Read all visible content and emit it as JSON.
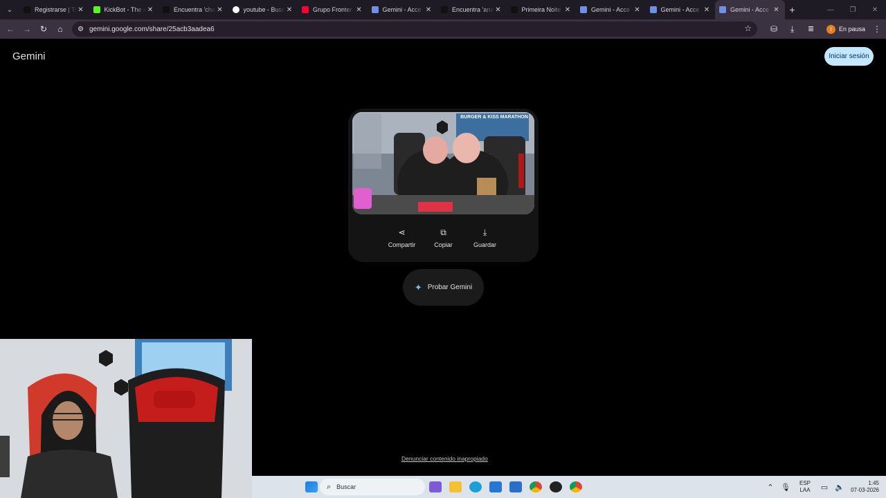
{
  "browser": {
    "tabs": [
      {
        "label": "Registrarse | TikTok",
        "icon": "tiktok-icon",
        "active": false
      },
      {
        "label": "KickBot - The #",
        "icon": "kick-icon",
        "active": false
      },
      {
        "label": "Encuentra 'cha",
        "icon": "tiktok-icon",
        "active": false
      },
      {
        "label": "youtube - Busc",
        "icon": "google-icon",
        "active": false
      },
      {
        "label": "Grupo Fronter",
        "icon": "youtube-icon",
        "active": false
      },
      {
        "label": "Gemini - Acce",
        "icon": "gemini-icon",
        "active": false
      },
      {
        "label": "Encuentra 'ana",
        "icon": "tiktok-icon",
        "active": false
      },
      {
        "label": "Primeira Noite",
        "icon": "tiktok-icon",
        "active": false
      },
      {
        "label": "Gemini - Acce",
        "icon": "gemini-icon",
        "active": false
      },
      {
        "label": "Gemini - Acce",
        "icon": "gemini-icon",
        "active": false
      },
      {
        "label": "Gemini - Acce",
        "icon": "gemini-icon",
        "active": true
      }
    ],
    "url": "gemini.google.com/share/25acb3aadea6",
    "profile_status": "En pausa",
    "profile_initial": "I"
  },
  "page": {
    "brand": "Gemini",
    "signin_label": "Iniciar sesión",
    "image_caption": "BURGER & KISS MARATHON",
    "actions": [
      {
        "label": "Compartir",
        "icon": "share-icon"
      },
      {
        "label": "Copiar",
        "icon": "copy-icon"
      },
      {
        "label": "Guardar",
        "icon": "download-icon"
      }
    ],
    "try_label": "Probar Gemini",
    "report_link": "Denunciar contenido inapropiado"
  },
  "taskbar": {
    "search_placeholder": "Buscar",
    "lang_top": "ESP",
    "lang_bottom": "LAA",
    "time": "1:45",
    "date": "07-03-2026"
  }
}
